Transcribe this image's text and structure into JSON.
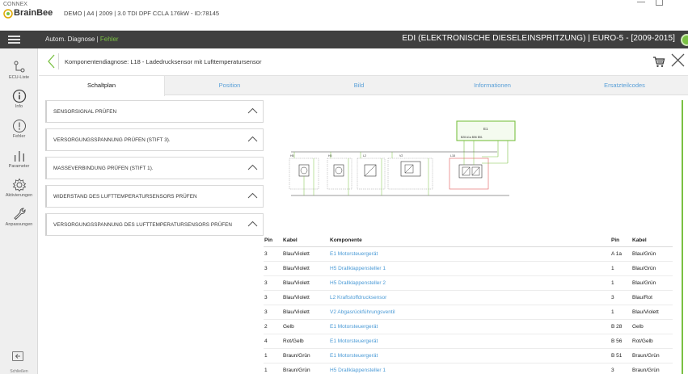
{
  "window": {
    "brand_top": "CONNEX",
    "brand_name": "BrainBee",
    "doc_info": "DEMO | A4 | 2009 | 3.0 TDI DPF CCLA 176kW - ID:78145"
  },
  "header": {
    "crumb_base": "Autom. Diagnose",
    "crumb_sep": " | ",
    "crumb_active": "Fehler",
    "system": "EDI (ELEKTRONISCHE DIESELEINSPRITZUNG) | EURO-5 - [2009-2015]",
    "colors": {
      "accent": "#7ac143",
      "header_bg": "#3f3f3f",
      "link": "#4a9ad6"
    }
  },
  "sidebar": {
    "items": [
      {
        "label": "ECU-Liste",
        "icon": "ecu-list-icon"
      },
      {
        "label": "Info",
        "icon": "info-icon"
      },
      {
        "label": "Fehler",
        "icon": "fault-icon"
      },
      {
        "label": "Parameter",
        "icon": "parameter-icon"
      },
      {
        "label": "Aktivierungen",
        "icon": "gear-icon"
      },
      {
        "label": "Anpassungen",
        "icon": "wrench-icon"
      }
    ],
    "bottom_label": "Schließen"
  },
  "page": {
    "title": "Komponentendiagnose: L18 - Ladedrucksensor mit Lufttemperatursensor"
  },
  "tabs": [
    {
      "label": "Schaltplan",
      "active": true
    },
    {
      "label": "Position",
      "active": false
    },
    {
      "label": "Bild",
      "active": false
    },
    {
      "label": "Informationen",
      "active": false
    },
    {
      "label": "Ersatzteilcodes",
      "active": false
    }
  ],
  "checks": [
    "SENSORSIGNAL PRÜFEN",
    "VERSORGUNGSSPANNUNG PRÜFEN (STIFT 3).",
    "MASSEVERBINDUNG PRÜFEN (STIFT 1).",
    "WIDERSTAND DES LUFTTEMPERATURSENSORS PRÜFEN",
    "VERSORGUNGSSPANNUNG DES LUFTTEMPERATURSENSORS PRÜFEN"
  ],
  "diagram": {
    "ecu_label": "E1",
    "ecu_pins": "B28  A1a  B56  B51",
    "components": [
      "H5",
      "H5",
      "L2",
      "V2",
      "L18"
    ]
  },
  "table": {
    "headers": {
      "pin": "Pin",
      "kabel": "Kabel",
      "komponente": "Komponente",
      "pin2": "Pin",
      "kabel2": "Kabel"
    },
    "rows": [
      {
        "pin": "3",
        "kabel": "Blau/Violett",
        "komponente": "E1 Motorsteuergerät",
        "pin2": "A 1a",
        "kabel2": "Blau/Grün"
      },
      {
        "pin": "3",
        "kabel": "Blau/Violett",
        "komponente": "H5 Drallklappensteller 1",
        "pin2": "1",
        "kabel2": "Blau/Grün"
      },
      {
        "pin": "3",
        "kabel": "Blau/Violett",
        "komponente": "H5 Drallklappensteller 2",
        "pin2": "1",
        "kabel2": "Blau/Grün"
      },
      {
        "pin": "3",
        "kabel": "Blau/Violett",
        "komponente": "L2 Kraftstoffdrucksensor",
        "pin2": "3",
        "kabel2": "Blau/Rot"
      },
      {
        "pin": "3",
        "kabel": "Blau/Violett",
        "komponente": "V2 Abgasrückführungsventil",
        "pin2": "1",
        "kabel2": "Blau/Violett"
      },
      {
        "pin": "2",
        "kabel": "Gelb",
        "komponente": "E1 Motorsteuergerät",
        "pin2": "B 28",
        "kabel2": "Gelb"
      },
      {
        "pin": "4",
        "kabel": "Rot/Gelb",
        "komponente": "E1 Motorsteuergerät",
        "pin2": "B 56",
        "kabel2": "Rot/Gelb"
      },
      {
        "pin": "1",
        "kabel": "Braun/Grün",
        "komponente": "E1 Motorsteuergerät",
        "pin2": "B 51",
        "kabel2": "Braun/Grün"
      },
      {
        "pin": "1",
        "kabel": "Braun/Grün",
        "komponente": "H5 Drallklappensteller 1",
        "pin2": "3",
        "kabel2": "Braun/Grün"
      }
    ]
  }
}
